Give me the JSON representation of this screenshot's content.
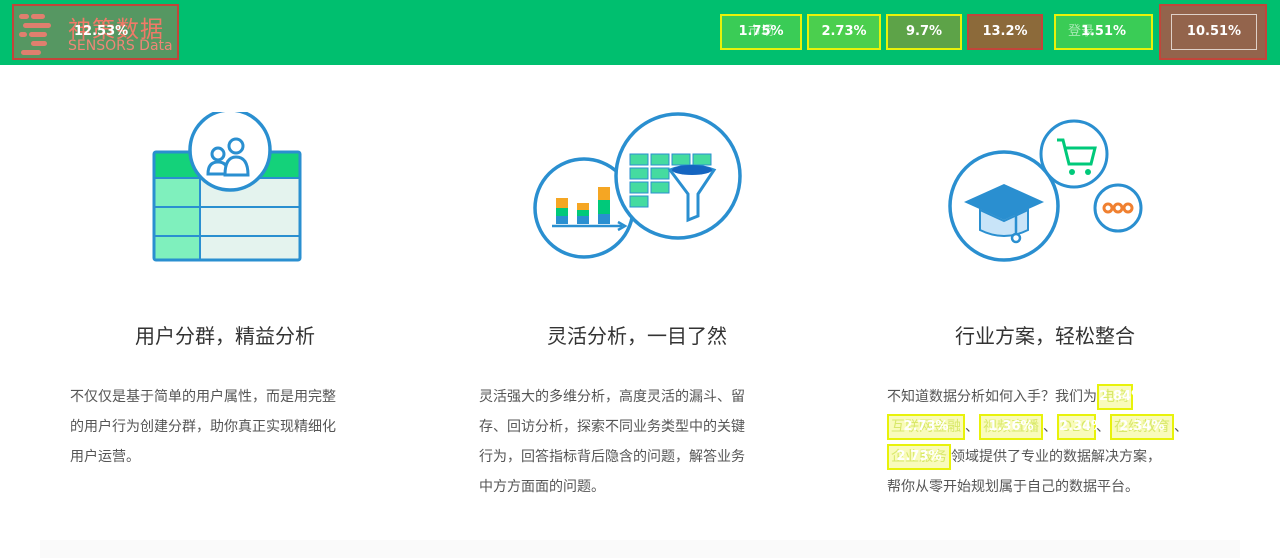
{
  "brand": {
    "name_cn": "神策数据",
    "name_en": "SENSORS Data",
    "overlay_pct": "12.53%"
  },
  "nav": {
    "items": [
      {
        "ghost": "市场",
        "pct": "1.75%"
      },
      {
        "ghost": "",
        "pct": "2.73%"
      },
      {
        "ghost": "",
        "pct": "9.7%"
      },
      {
        "ghost": "",
        "pct": "13.2%"
      },
      {
        "ghost": "登录",
        "pct": "1.51%"
      }
    ],
    "demo_pct": "10.51%"
  },
  "features": [
    {
      "title": "用户分群，精益分析",
      "lines": [
        "不仅仅是基于简单的用户属性，而是用完整",
        "的用户行为创建分群，助你真正实现精细化",
        "用户运营。"
      ]
    },
    {
      "title": "灵活分析，一目了然",
      "lines": [
        "灵活强大的多维分析，高度灵活的漏斗、留",
        "存、回访分析，探索不同业务类型中的关键",
        "行为，回答指标背后隐含的问题，解答业务",
        "中方方面面的问题。"
      ]
    },
    {
      "title": "行业方案，轻松整合",
      "line1_text": "不知道数据分析如何入手？我们为",
      "line1_hl": {
        "ghost": "电商",
        "pct": "2.84%"
      },
      "line2_hl": [
        {
          "ghost": "互联网金融",
          "pct": "2.73%"
        },
        {
          "ghost": "视频直播",
          "pct": "1.36%"
        },
        {
          "ghost": "O2O",
          "pct": "2.34%"
        },
        {
          "ghost": "在线教育",
          "pct": "2.34%"
        }
      ],
      "line3_hl": {
        "ghost": "企业服务",
        "pct": "2.73%"
      },
      "line3_text": "领域提供了专业的数据解决方案，",
      "line4_text": "帮你从零开始规划属于自己的数据平台。"
    }
  ],
  "colors": {
    "brand_green": "#00bf6f",
    "icon_blue": "#2a8fd0",
    "highlight_yellow": "#e8f20a",
    "highlight_red": "#c2453a"
  }
}
